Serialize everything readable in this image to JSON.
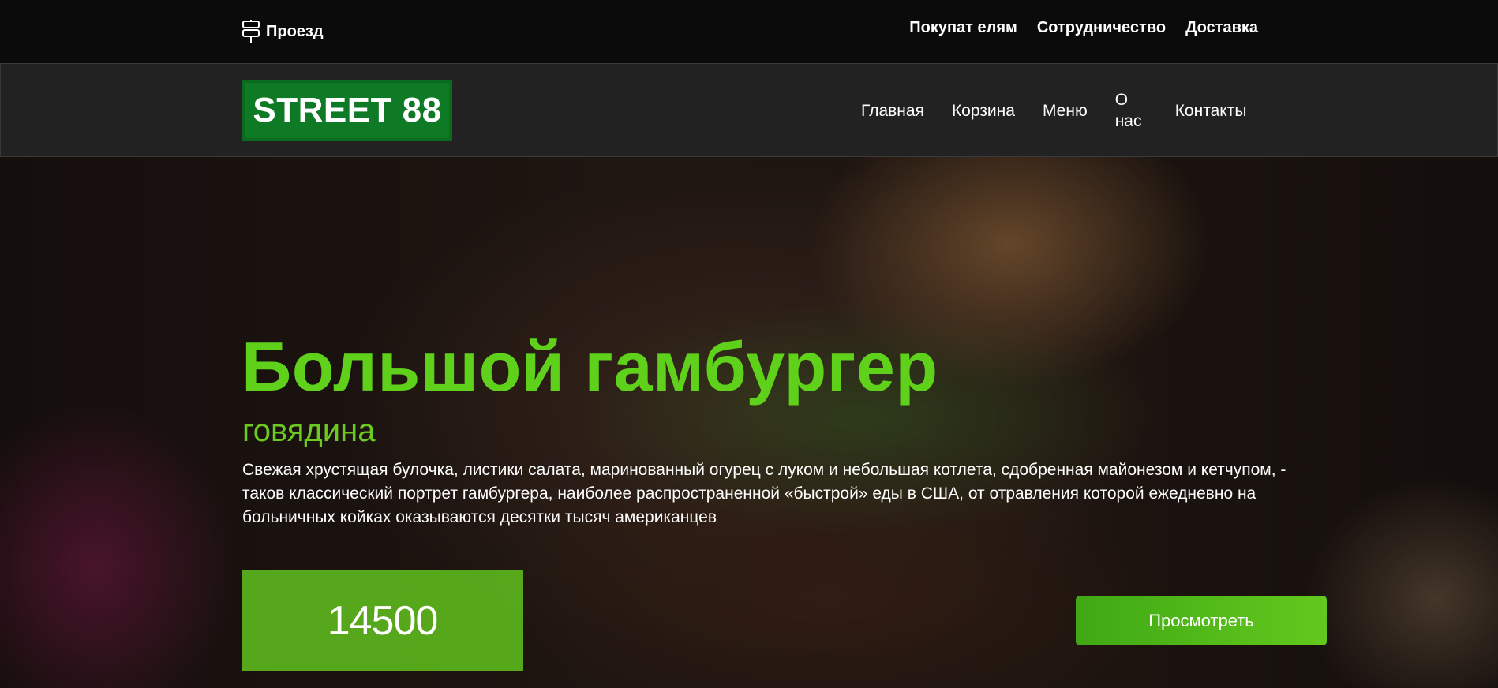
{
  "topbar": {
    "route_label": "Проезд",
    "route_icon": "signpost-icon",
    "links": [
      "Покупат елям",
      "Сотрудничество",
      "Доставка"
    ]
  },
  "header": {
    "logo_text": "STREET 88",
    "nav": [
      "Главная",
      "Корзина",
      "Меню",
      "О нас",
      "Контакты"
    ]
  },
  "hero": {
    "title": "Большой гамбургер",
    "subtitle": "говядина",
    "description": "Свежая хрустящая булочка, листики салата, маринованный огурец с луком и небольшая котлета, сдобренная майонезом и кетчупом, - таков классический портрет гамбургера, наиболее распространенной «быстрой» еды в США, от отравления которой ежедневно на больничных койках оказываются десятки тысяч американцев",
    "price": "14500",
    "view_button": "Просмотреть"
  },
  "colors": {
    "accent_green": "#5fd11b",
    "logo_green": "#0f7a25",
    "topbar_bg": "#0b0b0b",
    "header_bg": "#222222"
  }
}
